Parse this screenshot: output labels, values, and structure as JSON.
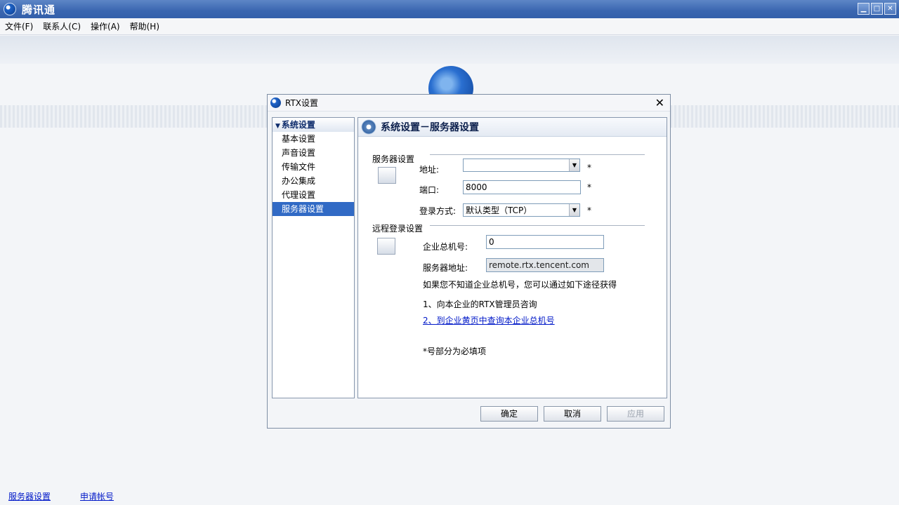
{
  "app": {
    "title": "腾讯通",
    "window_buttons": {
      "minimize": "▁",
      "maximize": "□",
      "close": "✕"
    }
  },
  "menu": [
    "文件(F)",
    "联系人(C)",
    "操作(A)",
    "帮助(H)"
  ],
  "bottom_links": [
    "服务器设置",
    "申请帐号"
  ],
  "dialog": {
    "title": "RTX设置",
    "close": "✕",
    "tree": {
      "root": "系统设置",
      "items": [
        "基本设置",
        "声音设置",
        "传输文件",
        "办公集成",
        "代理设置",
        "服务器设置"
      ],
      "selected": "服务器设置"
    },
    "panel_title": "系统设置－服务器设置",
    "server_section": {
      "label": "服务器设置",
      "address_label": "地址:",
      "address_value": "",
      "port_label": "端口:",
      "port_value": "8000",
      "login_label": "登录方式:",
      "login_value": "默认类型（TCP）",
      "required_mark": "*"
    },
    "remote_section": {
      "label": "远程登录设置",
      "company_label": "企业总机号:",
      "company_value": "0",
      "server_addr_label": "服务器地址:",
      "server_addr_value": "remote.rtx.tencent.com",
      "hint": "如果您不知道企业总机号，您可以通过如下途径获得",
      "way1": "1、向本企业的RTX管理员咨询",
      "way2": "2、到企业黄页中查询本企业总机号",
      "required_note": "*号部分为必填项"
    },
    "buttons": {
      "ok": "确定",
      "cancel": "取消",
      "apply": "应用"
    }
  }
}
